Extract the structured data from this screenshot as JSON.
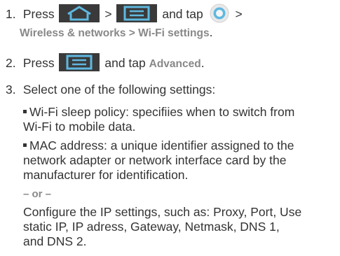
{
  "step1": {
    "number": "1.",
    "press": "Press",
    "gt1": ">",
    "gt2": ">",
    "and_tap": "and tap",
    "menu_path": "Wireless & networks > Wi-Fi settings",
    "menu_path_end": ".",
    "home_key": "home-icon",
    "menu_key": "menu-icon",
    "settings_icon": "settings-icon"
  },
  "step2": {
    "number": "2.",
    "press": "Press",
    "and_tap": "and tap",
    "target": "Advanced",
    "end": ".",
    "menu_key": "menu-icon"
  },
  "step3": {
    "number": "3.",
    "text": "Select one of the following settings:"
  },
  "bullets": [
    {
      "line1": "Wi-Fi sleep policy: specifiies when to switch from",
      "line2": "Wi-Fi to mobile data."
    },
    {
      "line1": "MAC address: a unique identifier assigned to the",
      "line2": "network adapter or network interface card by the",
      "line3": "manufacturer for identification."
    }
  ],
  "or_label": "– or –",
  "ip_paragraph": {
    "line1": "Configure the IP settings, such as: Proxy, Port, Use",
    "line2": "static IP, IP adress, Gateway, Netmask, DNS 1,",
    "line3": "and DNS 2."
  },
  "colors": {
    "text": "#333333",
    "highlight_text": "#888888",
    "hardkey_bg": "#3a3a3a",
    "icon_glyph": "#5fb8e0"
  }
}
